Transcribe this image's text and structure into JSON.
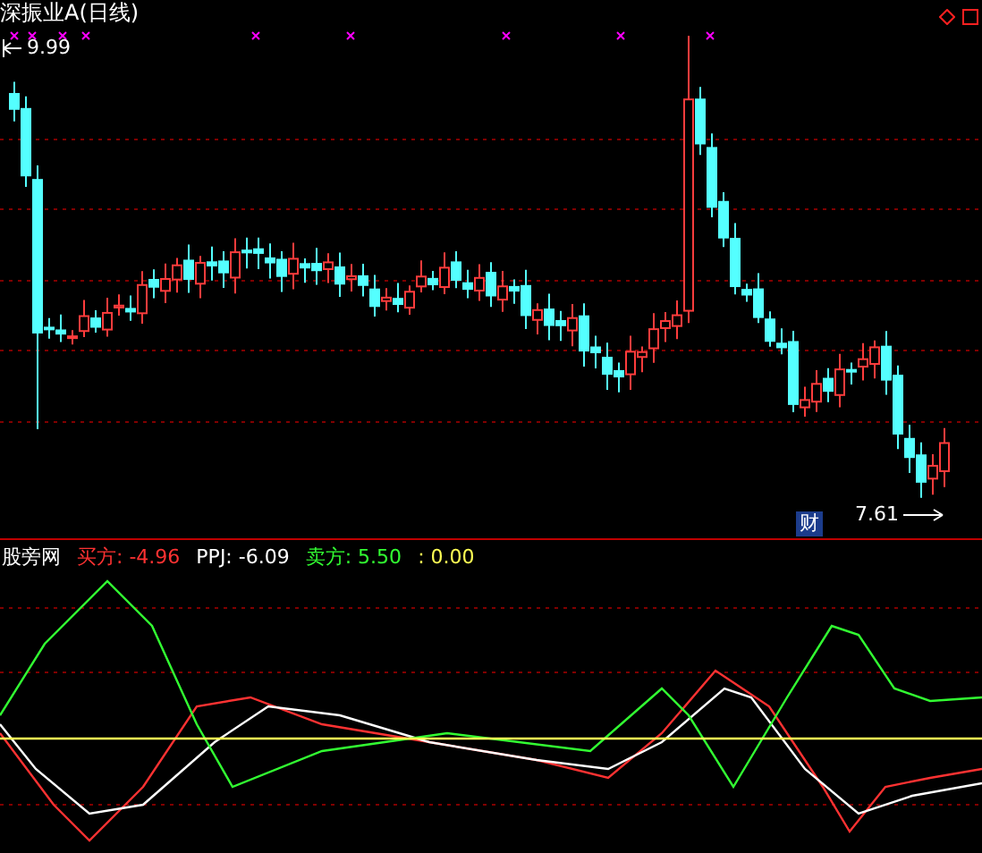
{
  "title": "深振业A(日线)",
  "price_high": "9.99",
  "price_low": "7.61",
  "event_badge": "财",
  "legend": {
    "name": "股旁网",
    "items": [
      {
        "text": "买方: -4.96",
        "color": "#ff3232"
      },
      {
        "text": "PPJ: -6.09",
        "color": "#ffffff"
      },
      {
        "text": "卖方: 5.50",
        "color": "#32ff32"
      },
      {
        "text": ": 0.00",
        "color": "#ffff54"
      }
    ]
  }
}
